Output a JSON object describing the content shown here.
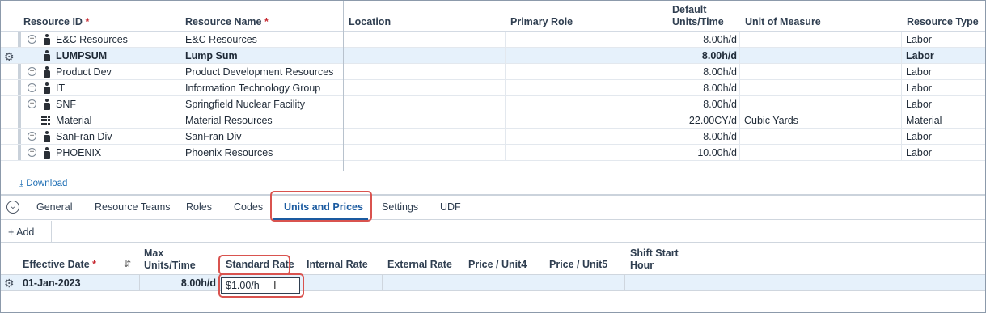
{
  "grid": {
    "headers": {
      "resource_id": "Resource ID",
      "resource_name": "Resource Name",
      "location": "Location",
      "primary_role": "Primary Role",
      "default_units_1": "Default",
      "default_units_2": "Units/Time",
      "unit_of_measure": "Unit of Measure",
      "resource_type": "Resource Type",
      "required_mark": "*"
    },
    "rows": [
      {
        "id": "E&C Resources",
        "name": "E&C Resources",
        "units": "8.00h/d",
        "uom": "",
        "type": "Labor"
      },
      {
        "id": "LUMPSUM",
        "name": "Lump Sum",
        "units": "8.00h/d",
        "uom": "",
        "type": "Labor"
      },
      {
        "id": "Product Dev",
        "name": "Product Development Resources",
        "units": "8.00h/d",
        "uom": "",
        "type": "Labor"
      },
      {
        "id": "IT",
        "name": "Information Technology Group",
        "units": "8.00h/d",
        "uom": "",
        "type": "Labor"
      },
      {
        "id": "SNF",
        "name": "Springfield Nuclear Facility",
        "units": "8.00h/d",
        "uom": "",
        "type": "Labor"
      },
      {
        "id": "Material",
        "name": "Material Resources",
        "units": "22.00CY/d",
        "uom": "Cubic Yards",
        "type": "Material"
      },
      {
        "id": "SanFran Div",
        "name": "SanFran Div",
        "units": "8.00h/d",
        "uom": "",
        "type": "Labor"
      },
      {
        "id": "PHOENIX",
        "name": "Phoenix Resources",
        "units": "10.00h/d",
        "uom": "",
        "type": "Labor"
      }
    ]
  },
  "download_label": "Download",
  "tabs": [
    "General",
    "Resource Teams",
    "Roles",
    "Codes",
    "Units and Prices",
    "Settings",
    "UDF"
  ],
  "toolbar": {
    "add_label": "Add"
  },
  "units_grid": {
    "headers": {
      "effective_date": "Effective Date",
      "max_units_1": "Max",
      "max_units_2": "Units/Time",
      "standard_rate": "Standard Rate",
      "internal_rate": "Internal Rate",
      "external_rate": "External Rate",
      "price_unit4": "Price / Unit4",
      "price_unit5": "Price / Unit5",
      "shift_start_1": "Shift Start",
      "shift_start_2": "Hour"
    },
    "row": {
      "effective_date": "01-Jan-2023",
      "max_units": "8.00h/d",
      "standard_rate": "$1.00/h"
    }
  },
  "colors": {
    "accent": "#1a5aa0",
    "highlight": "#d9534f",
    "selected_row": "#e6f1fb"
  }
}
